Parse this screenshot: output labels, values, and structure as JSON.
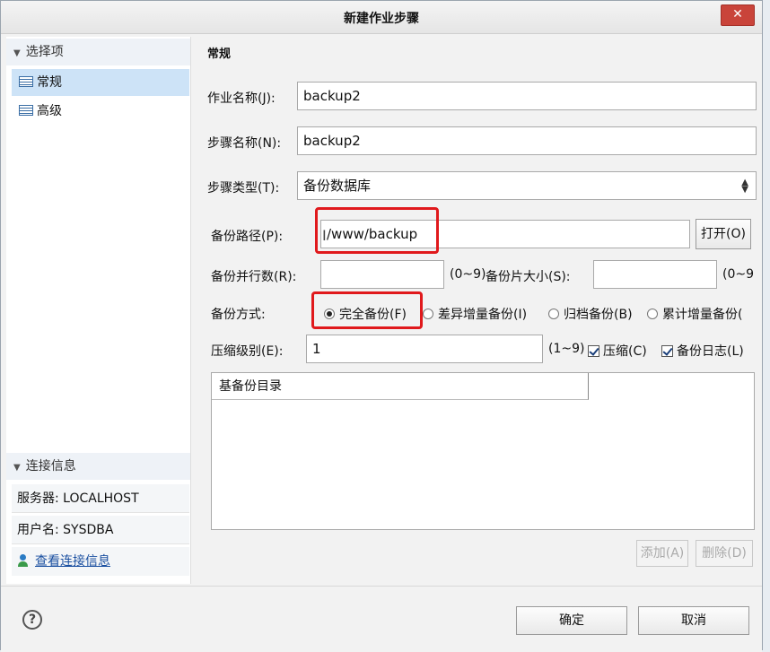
{
  "window": {
    "title": "新建作业步骤",
    "close_glyph": "✕"
  },
  "left": {
    "select_header": "选择项",
    "items": [
      {
        "label": "常规"
      },
      {
        "label": "高级"
      }
    ],
    "conn_header": "连接信息",
    "server": "服务器: LOCALHOST",
    "user": "用户名: SYSDBA",
    "view_link": "查看连接信息"
  },
  "main": {
    "heading": "常规",
    "job_name_label": "作业名称(J):",
    "job_name_value": "backup2",
    "step_name_label": "步骤名称(N):",
    "step_name_value": "backup2",
    "step_type_label": "步骤类型(T):",
    "step_type_value": "备份数据库",
    "backup_path_label": "备份路径(P):",
    "backup_path_value": "/www/backup",
    "open_button": "打开(O)",
    "parallel_label": "备份并行数(R):",
    "parallel_value": "",
    "parallel_range": "(0~9)",
    "piece_size_label": "备份片大小(S):",
    "piece_size_value": "",
    "piece_size_range": "(0~9",
    "method_label": "备份方式:",
    "methods": [
      {
        "label": "完全备份(F)",
        "selected": true
      },
      {
        "label": "差异增量备份(I)",
        "selected": false
      },
      {
        "label": "归档备份(B)",
        "selected": false
      },
      {
        "label": "累计增量备份(",
        "selected": false
      }
    ],
    "compress_level_label": "压缩级别(E):",
    "compress_level_value": "1",
    "compress_range": "(1~9)",
    "compress_check": "压缩(C)",
    "compress_checked": true,
    "log_check": "备份日志(L)",
    "log_checked": true,
    "base_dir_header": "基备份目录",
    "add_button": "添加(A)",
    "delete_button": "删除(D)"
  },
  "footer": {
    "ok": "确定",
    "cancel": "取消"
  },
  "colors": {
    "highlight_red": "#e0191c",
    "selection_blue": "#cde3f7",
    "close_red": "#c9443a"
  }
}
